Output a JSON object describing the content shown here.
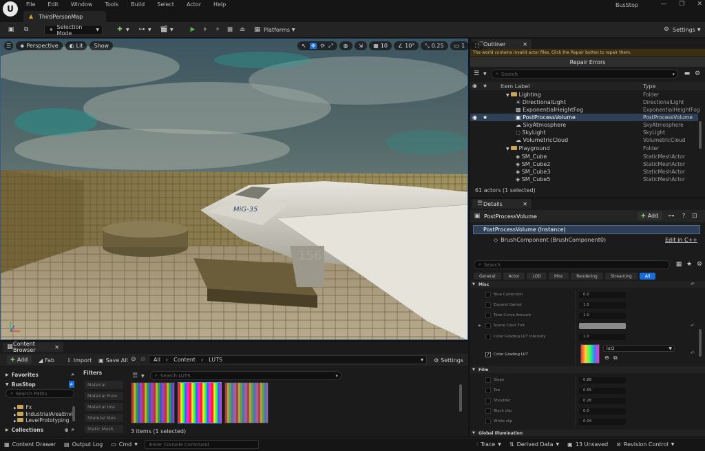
{
  "app": {
    "logo": "U",
    "project": "BusStop"
  },
  "menu": [
    "File",
    "Edit",
    "Window",
    "Tools",
    "Build",
    "Select",
    "Actor",
    "Help"
  ],
  "window_controls": [
    "—",
    "❐",
    "✕"
  ],
  "tab": {
    "title": "ThirdPersonMap"
  },
  "toolbar": {
    "selection_mode": "Selection Mode",
    "platforms": "Platforms",
    "settings": "Settings"
  },
  "viewport": {
    "perspective": "Perspective",
    "lit": "Lit",
    "show": "Show",
    "grid_snap": "10",
    "rot_snap": "10°",
    "scale_snap": "0.25",
    "camera_speed": "1",
    "jet_text": "MiG-35",
    "jet_number": "156"
  },
  "outliner": {
    "tab": "Outliner",
    "warning": "The world contains invalid actor files. Click the Repair button to repair them.",
    "repair": "Repair Errors",
    "search_placeholder": "Search",
    "col_label": "Item Label",
    "col_type": "Type",
    "rows": [
      {
        "label": "Lighting",
        "type": "Folder"
      },
      {
        "label": "DirectionalLight",
        "type": "DirectionalLight"
      },
      {
        "label": "ExponentialHeightFog",
        "type": "ExponentialHeightFog"
      },
      {
        "label": "PostProcessVolume",
        "type": "PostProcessVolume"
      },
      {
        "label": "SkyAtmosphere",
        "type": "SkyAtmosphere"
      },
      {
        "label": "SkyLight",
        "type": "SkyLight"
      },
      {
        "label": "VolumetricCloud",
        "type": "VolumetricCloud"
      },
      {
        "label": "Playground",
        "type": "Folder"
      },
      {
        "label": "SM_Cube",
        "type": "StaticMeshActor"
      },
      {
        "label": "SM_Cube2",
        "type": "StaticMeshActor"
      },
      {
        "label": "SM_Cube3",
        "type": "StaticMeshActor"
      },
      {
        "label": "SM_Cube5",
        "type": "StaticMeshActor"
      }
    ],
    "count": "61 actors (1 selected)"
  },
  "details": {
    "tab": "Details",
    "title": "PostProcessVolume",
    "add": "Add",
    "instance": "PostProcessVolume (Instance)",
    "component": "BrushComponent (BrushComponent0)",
    "edit_cpp": "Edit in C++",
    "search_placeholder": "Search",
    "categories": [
      "General",
      "Actor",
      "LOD",
      "Misc",
      "Rendering",
      "Streaming",
      "All"
    ],
    "misc_header": "Misc",
    "misc": [
      {
        "label": "Blue Correction",
        "value": "0.0"
      },
      {
        "label": "Expand Gamut",
        "value": "1.0"
      },
      {
        "label": "Tone Curve Amount",
        "value": "1.0"
      },
      {
        "label": "Scene Color Tint",
        "value": ""
      },
      {
        "label": "Color Grading LUT Intensity",
        "value": "1.0"
      }
    ],
    "lut": {
      "label": "Color Grading LUT",
      "asset": "lut2"
    },
    "film_header": "Film",
    "film": [
      {
        "label": "Slope",
        "value": "0.88"
      },
      {
        "label": "Toe",
        "value": "0.55"
      },
      {
        "label": "Shoulder",
        "value": "0.26"
      },
      {
        "label": "Black clip",
        "value": "0.0"
      },
      {
        "label": "White clip",
        "value": "0.04"
      }
    ],
    "gi_header": "Global Illumination"
  },
  "content_browser": {
    "tab": "Content Browser",
    "add": "Add",
    "fab": "Fab",
    "import": "Import",
    "save_all": "Save All",
    "path": [
      "All",
      "Content",
      "LUTS"
    ],
    "settings": "Settings",
    "favorites": "Favorites",
    "project": "BusStop",
    "search_paths": "Search Paths",
    "tree": [
      "Fx",
      "IndustrialAreaEnvir",
      "LevelPrototyping"
    ],
    "collections": "Collections",
    "filters": "Filters",
    "filter_items": [
      "Material",
      "Material Func",
      "Material Inst",
      "Skeletal Mes",
      "Static Mesh"
    ],
    "search_luts": "Search LUTS",
    "count": "3 items (1 selected)"
  },
  "statusbar": {
    "content_drawer": "Content Drawer",
    "output_log": "Output Log",
    "cmd": "Cmd",
    "console_placeholder": "Enter Console Command",
    "trace": "Trace",
    "derived_data": "Derived Data",
    "unsaved": "13 Unsaved",
    "revision": "Revision Control"
  }
}
